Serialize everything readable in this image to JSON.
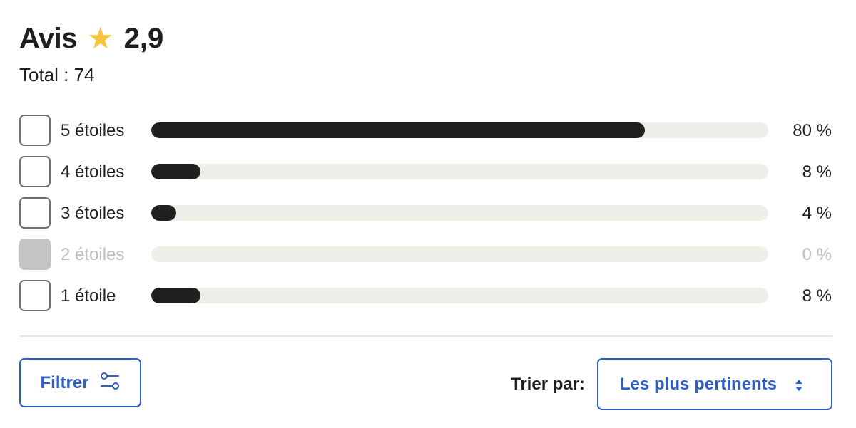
{
  "header": {
    "title": "Avis",
    "star_icon": "★",
    "rating": "2,9",
    "total": "Total : 74",
    "star_color": "#f5c43c"
  },
  "rating_rows": [
    {
      "label": "5 étoiles",
      "percent_text": "80 %",
      "percent": 80,
      "disabled": false
    },
    {
      "label": "4 étoiles",
      "percent_text": "8 %",
      "percent": 8,
      "disabled": false
    },
    {
      "label": "3 étoiles",
      "percent_text": "4 %",
      "percent": 4,
      "disabled": false
    },
    {
      "label": "2 étoiles",
      "percent_text": "0 %",
      "percent": 0,
      "disabled": true
    },
    {
      "label": "1 étoile",
      "percent_text": "8 %",
      "percent": 8,
      "disabled": false
    }
  ],
  "filter": {
    "label": "Filtrer",
    "icon": "filter-sliders-icon"
  },
  "sort": {
    "label": "Trier par:",
    "selected": "Les plus pertinents",
    "icon": "sort-arrows-icon"
  },
  "colors": {
    "accent": "#2f5fc4",
    "bar_fill": "#1f1f1f",
    "bar_track": "#f0eee8",
    "disabled": "#c4c4c4"
  }
}
